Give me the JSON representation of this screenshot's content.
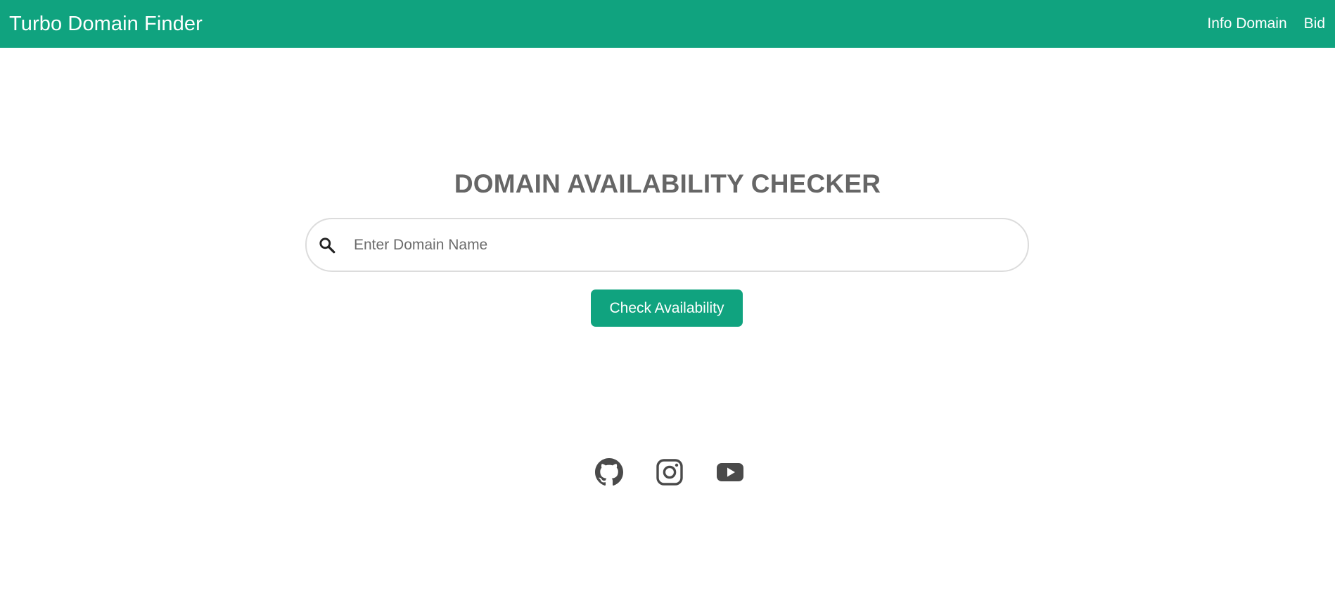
{
  "header": {
    "brand": "Turbo Domain Finder",
    "nav": [
      {
        "label": "Info Domain"
      },
      {
        "label": "Bid"
      }
    ],
    "background_color": "#10a37f"
  },
  "main": {
    "title": "DOMAIN AVAILABILITY CHECKER",
    "search": {
      "icon": "search-icon",
      "value": "",
      "placeholder": "Enter Domain Name"
    },
    "check_button_label": "Check Availability"
  },
  "footer": {
    "social_icons": [
      "github-icon",
      "instagram-icon",
      "youtube-icon"
    ],
    "icon_color": "#4a4a4a"
  },
  "accent_color": "#10a37f"
}
